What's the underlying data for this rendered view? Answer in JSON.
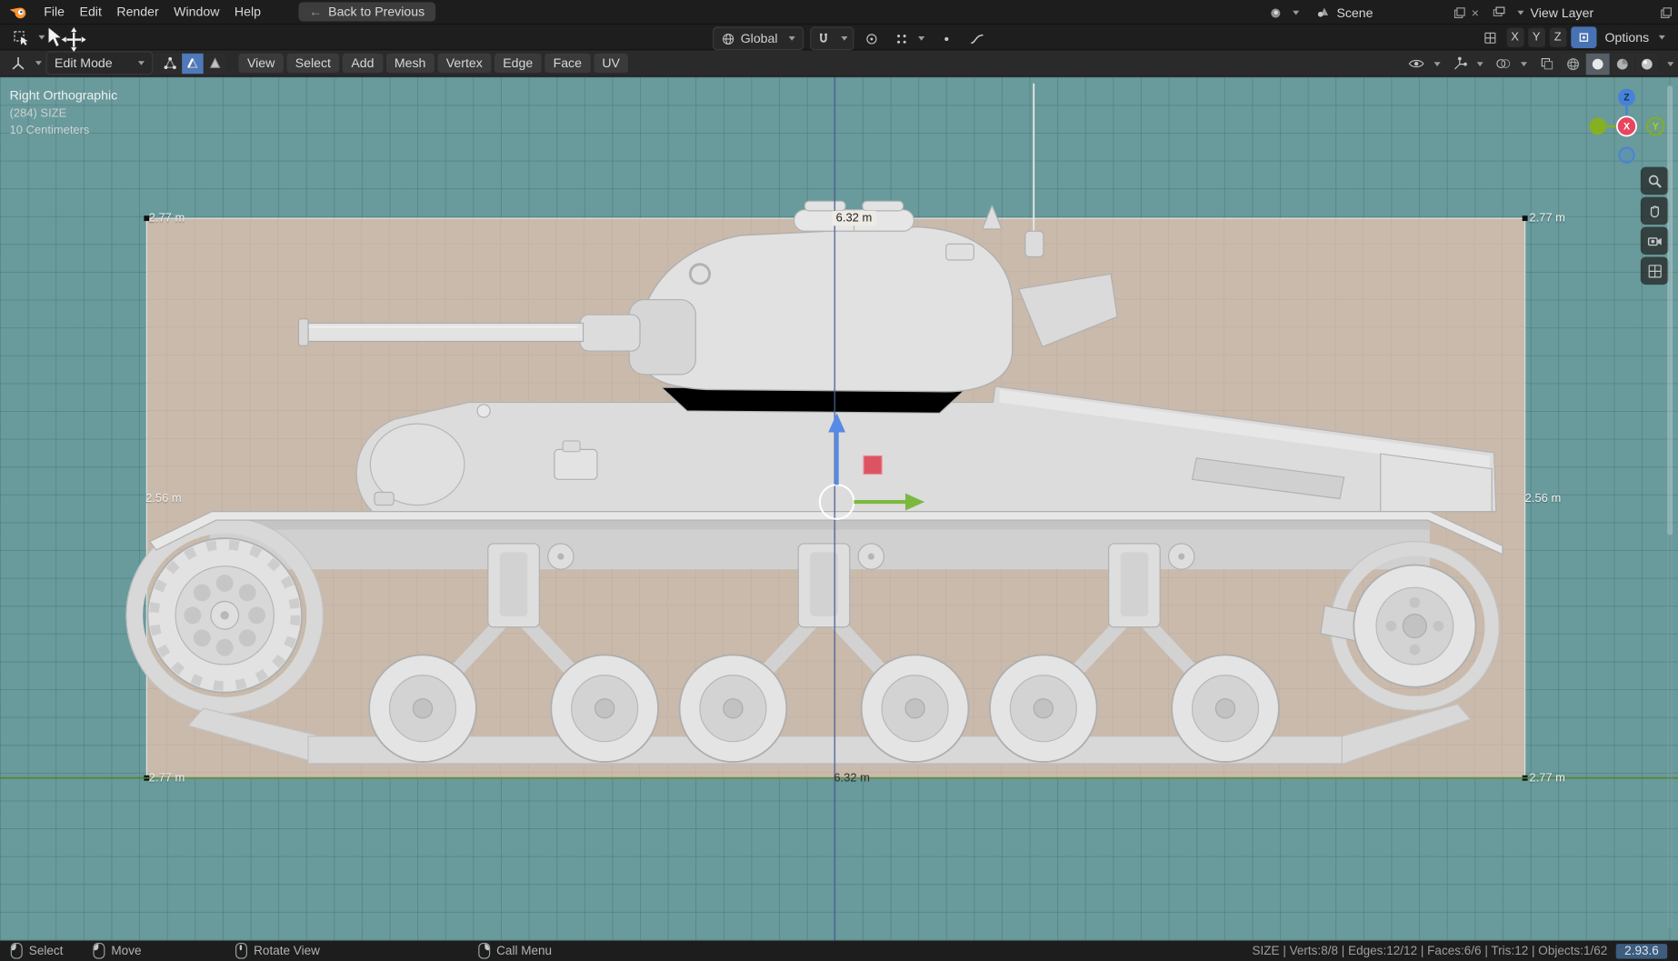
{
  "topbar": {
    "menus": [
      "File",
      "Edit",
      "Render",
      "Window",
      "Help"
    ],
    "back_button_label": "Back to Previous",
    "scene_label": "Scene",
    "view_layer_label": "View Layer"
  },
  "tool_settings": {
    "orientation_label": "Global",
    "mirror_axes": [
      "X",
      "Y",
      "Z"
    ],
    "options_label": "Options"
  },
  "header": {
    "mode_label": "Edit Mode",
    "menus": [
      "View",
      "Select",
      "Add",
      "Mesh",
      "Vertex",
      "Edge",
      "Face",
      "UV"
    ]
  },
  "viewport": {
    "info_lines": [
      "Right Orthographic",
      "(284) SIZE",
      "10 Centimeters"
    ],
    "measurements": {
      "top_left": "2.77 m",
      "top_center": "6.32 m",
      "top_right": "2.77 m",
      "mid_left": "2.56 m",
      "mid_right": "2.56 m",
      "bottom_left": "2.77 m",
      "bottom_center": "6.32 m",
      "bottom_right": "2.77 m"
    },
    "nav_gizmo": {
      "x_label": "X",
      "y_label": "Y",
      "z_label": "Z"
    }
  },
  "status_bar": {
    "hints": [
      {
        "icon": "mouse-left",
        "label": "Select"
      },
      {
        "icon": "mouse-left-drag",
        "label": "Move"
      },
      {
        "icon": "mouse-middle",
        "label": "Rotate View"
      },
      {
        "icon": "mouse-right",
        "label": "Call Menu"
      }
    ],
    "stats_text": "SIZE | Verts:8/8 | Edges:12/12 | Faces:6/6 | Tris:12 | Objects:1/62",
    "version": "2.93.6"
  },
  "icons": {
    "back_arrow": "←",
    "close": "×"
  },
  "colors": {
    "accent": "#4772b3",
    "viewport_bg": "#699a9c",
    "plane": "#c9baac",
    "axis_x": "#e8455e",
    "axis_y": "#84b021",
    "axis_z": "#4782da"
  }
}
